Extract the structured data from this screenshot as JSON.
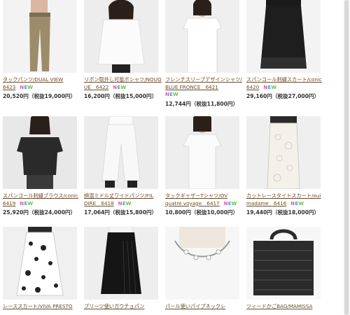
{
  "products": [
    {
      "name": "タックパンツ/DUAL VIEW\n6423",
      "new": "NEW",
      "price": "20,520円（税抜19,000円）",
      "color": "#9c8c6a",
      "bg": "#f3f3f3",
      "type": "pants"
    },
    {
      "name": "リボン取外し可能ボシャツ/NOUQUE　6422",
      "new": "NEW",
      "price": "16,200円（税抜15,000円）",
      "color": "#f7f7f7",
      "bg": "#eeeeee",
      "type": "shirt"
    },
    {
      "name": "フレンチスリーブデザインシャツ/BLUE FRONCE　6421",
      "new": "NEW",
      "price": "12,744円（税抜11,800円）",
      "color": "#ffffff",
      "bg": "#efefef",
      "type": "tee"
    },
    {
      "name": "スパンコール刺繍スカート/conic\n6420",
      "new": "NEW",
      "price": "29,160円（税抜27,000円）",
      "color": "#1e1e1e",
      "bg": "#f3f3f3",
      "type": "skirt"
    },
    {
      "name": "スパンコール刺繍ブラウス/conic\n6419",
      "new": "NEW",
      "price": "25,920円（税抜24,000円）",
      "color": "#2a2a2a",
      "bg": "#e8e8e8",
      "type": "blouse"
    },
    {
      "name": "綿混ミドル丈ワイドパンツ/FIL\nDIRE　6418",
      "new": "NEW",
      "price": "17,064円（税抜15,800円）",
      "color": "#f7f7f7",
      "bg": "#ececec",
      "type": "widepants"
    },
    {
      "name": "タックギャザーTシャツ/OV\nquatre voyage　6417",
      "new": "NEW",
      "price": "10,800円（税抜10,000円）",
      "color": "#fafafa",
      "bg": "#eeeeee",
      "type": "tee"
    },
    {
      "name": "カットレースタイトスカート/oui\nmadame　6416",
      "new": "NEW",
      "price": "19,440円（税抜18,000円）",
      "color": "#f4f1ea",
      "bg": "#efefef",
      "type": "lace"
    },
    {
      "name": "レーススカート/VIVA PRESTO",
      "new": "",
      "price": "",
      "color": "#ffffff",
      "bg": "#f0f0f0",
      "type": "patterned"
    },
    {
      "name": "プリーツ使いガウチョパン",
      "new": "",
      "price": "",
      "color": "#151515",
      "bg": "#eeeeee",
      "type": "gaucho"
    },
    {
      "name": "パール使いパイプネックレ",
      "new": "",
      "price": "",
      "color": "#c9c9c9",
      "bg": "#ffffff",
      "type": "necklace"
    },
    {
      "name": "ツィードかごBAG/MAMISSA",
      "new": "",
      "price": "",
      "color": "#2b2b2b",
      "bg": "#f7f7f7",
      "type": "bag"
    }
  ]
}
